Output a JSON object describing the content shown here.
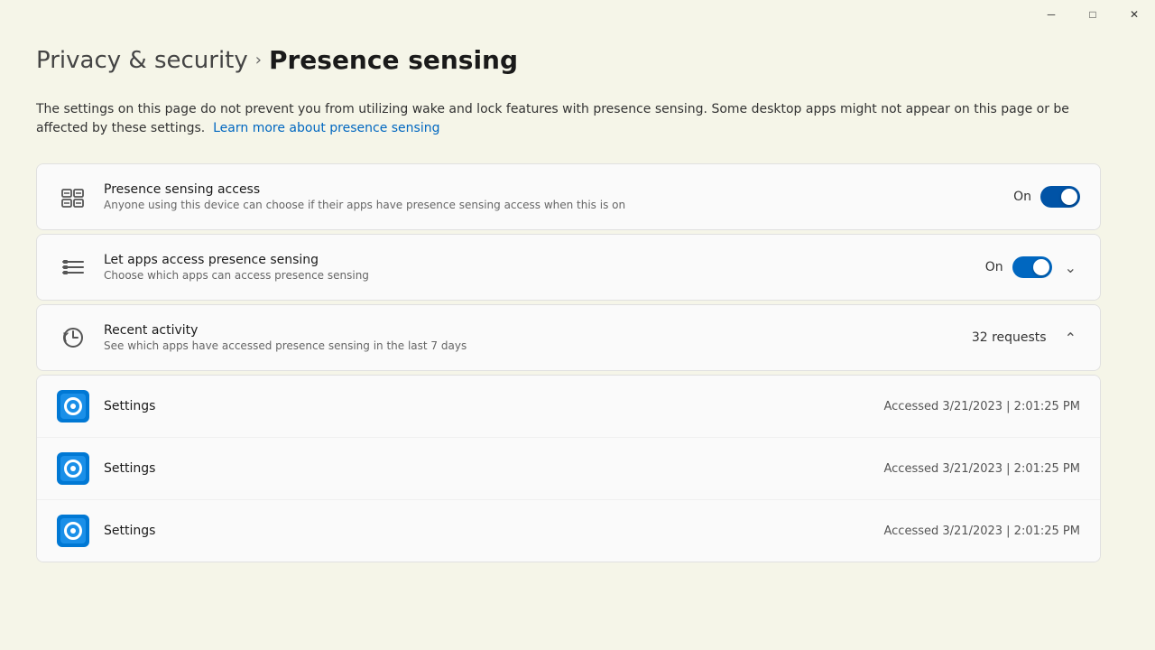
{
  "titlebar": {
    "minimize_label": "─",
    "maximize_label": "□",
    "close_label": "✕"
  },
  "breadcrumb": {
    "parent": "Privacy & security",
    "separator": "›",
    "current": "Presence sensing"
  },
  "description": {
    "text": "The settings on this page do not prevent you from utilizing wake and lock features with presence sensing. Some desktop apps might not appear on this page or be affected by these settings.",
    "link_text": "Learn more about presence sensing"
  },
  "settings": {
    "presence_access": {
      "title": "Presence sensing access",
      "subtitle": "Anyone using this device can choose if their apps have presence sensing access when this is on",
      "status": "On",
      "toggle_on": true
    },
    "let_apps": {
      "title": "Let apps access presence sensing",
      "subtitle": "Choose which apps can access presence sensing",
      "status": "On",
      "toggle_on": true
    },
    "recent_activity": {
      "title": "Recent activity",
      "subtitle": "See which apps have accessed presence sensing in the last 7 days",
      "count": "32 requests"
    }
  },
  "activity_items": [
    {
      "app_name": "Settings",
      "access_info": "Accessed 3/21/2023  |  2:01:25 PM"
    },
    {
      "app_name": "Settings",
      "access_info": "Accessed 3/21/2023  |  2:01:25 PM"
    },
    {
      "app_name": "Settings",
      "access_info": "Accessed 3/21/2023  |  2:01:25 PM"
    }
  ]
}
